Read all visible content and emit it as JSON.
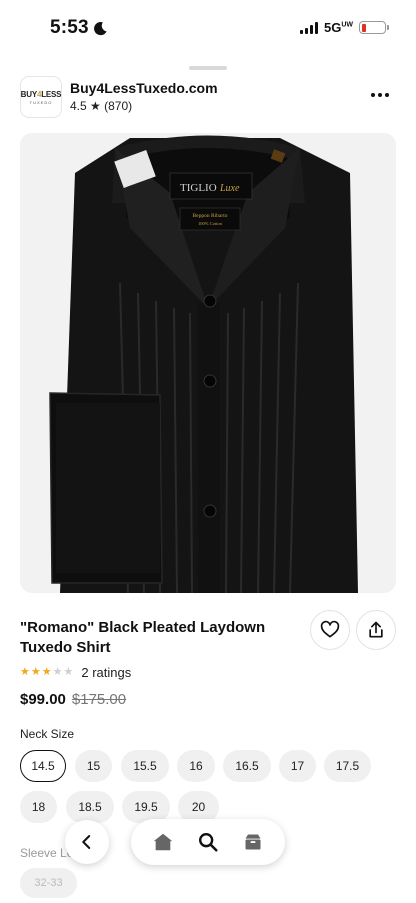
{
  "status_bar": {
    "time": "5:53",
    "network": "5G",
    "network_sup": "UW",
    "battery_color": "#e0302a"
  },
  "store": {
    "logo_main_a": "BUY",
    "logo_main_b": "4",
    "logo_main_c": "LESS",
    "logo_sub": "TUXEDO",
    "name": "Buy4LessTuxedo.com",
    "rating": "4.5 ★ (870)"
  },
  "product": {
    "title": "\"Romano\" Black Pleated Laydown Tuxedo Shirt",
    "stars_filled": 3,
    "stars_total": 5,
    "ratings_text": "2 ratings",
    "price": "$99.00",
    "old_price": "$175.00",
    "image_label_brand": "TIGLIO",
    "image_label_sub": "Luxe",
    "image_tag_line1": "Beppon Ribarto",
    "image_tag_line2": "100% Cotton"
  },
  "neck_size": {
    "label": "Neck Size",
    "options": [
      "14.5",
      "15",
      "15.5",
      "16",
      "16.5",
      "17",
      "17.5",
      "18",
      "18.5",
      "19.5",
      "20"
    ],
    "selected": "14.5"
  },
  "sleeve": {
    "label": "Sleeve Le",
    "first_option": "32-33"
  },
  "nav": {
    "icons": [
      "back-icon",
      "home-icon",
      "search-icon",
      "box-icon"
    ]
  }
}
